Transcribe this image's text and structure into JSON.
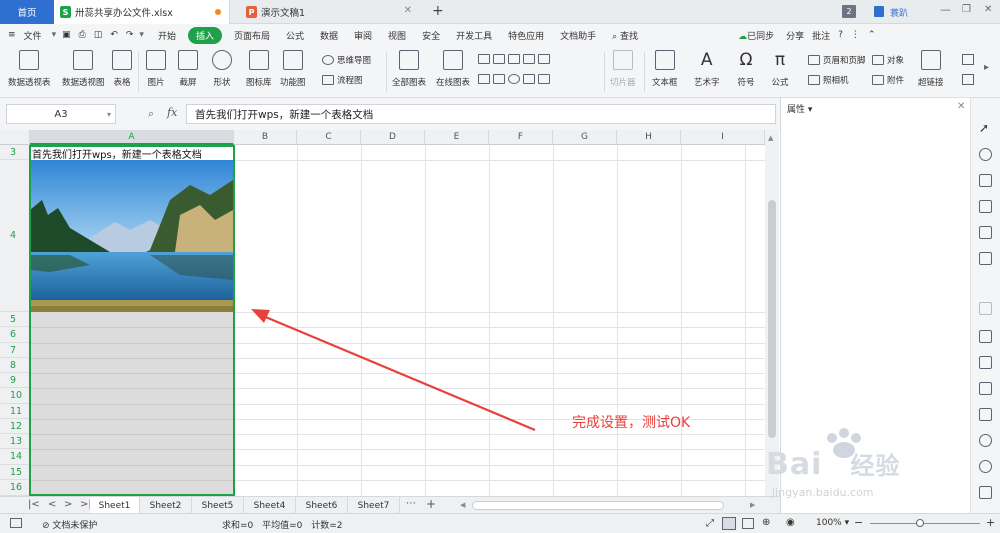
{
  "titlebar": {
    "home_tab": "首页",
    "tabs": [
      {
        "label": "卅蕊共享办公文件.xlsx",
        "icon": "S",
        "active": true
      },
      {
        "label": "演示文稿1",
        "icon": "P",
        "active": false
      }
    ],
    "new_tab": "+",
    "badge": "2",
    "user": "蓑趴"
  },
  "menubar": {
    "file": "文件",
    "items": [
      "开始",
      "插入",
      "页面布局",
      "公式",
      "数据",
      "审阅",
      "视图",
      "安全",
      "开发工具",
      "特色应用",
      "文档助手"
    ],
    "selected": "插入",
    "search": "查找",
    "sync": "已同步",
    "share": "分享",
    "comment": "批注",
    "help": "?"
  },
  "ribbon": {
    "pivot_table": "数据透视表",
    "pivot_chart": "数据透视图",
    "table": "表格",
    "picture": "图片",
    "screenshot": "截屏",
    "shapes": "形状",
    "icon_lib": "图标库",
    "func_chart": "功能图",
    "mindmap": "思维导图",
    "flowchart": "流程图",
    "all_charts": "全部图表",
    "online_chart": "在线图表",
    "slicer": "切片器",
    "textbox": "文本框",
    "wordart": "艺术字",
    "symbol": "符号",
    "formula": "公式",
    "header_footer": "页眉和页脚",
    "camera": "照相机",
    "object": "对象",
    "attachment": "附件",
    "hyperlink": "超链接"
  },
  "formula_bar": {
    "name_box": "A3",
    "fx": "fx",
    "content": "首先我们打开wps，新建一个表格文档"
  },
  "sheet": {
    "columns": [
      "A",
      "B",
      "C",
      "D",
      "E",
      "F",
      "G",
      "H",
      "I"
    ],
    "rows": [
      "3",
      "4",
      "5",
      "6",
      "7",
      "8",
      "9",
      "10",
      "11",
      "12",
      "13",
      "14",
      "15",
      "16"
    ],
    "a3_text": "首先我们打开wps，新建一个表格文档",
    "annotation": "完成设置，测试OK"
  },
  "panel": {
    "title": "属性"
  },
  "sheet_tabs": [
    "Sheet1",
    "Sheet2",
    "Sheet5",
    "Sheet4",
    "Sheet6",
    "Sheet7"
  ],
  "status": {
    "protect": "文档未保护",
    "summary": "求和=0 平均值=0 计数=2",
    "zoom": "100%"
  },
  "watermark": {
    "brand": "Bai",
    "brand2": "经验",
    "url": "jingyan.baidu.com"
  },
  "colors": {
    "accent": "#1fa14a",
    "tab_blue": "#2f6fcf",
    "arrow": "#e8403c"
  }
}
